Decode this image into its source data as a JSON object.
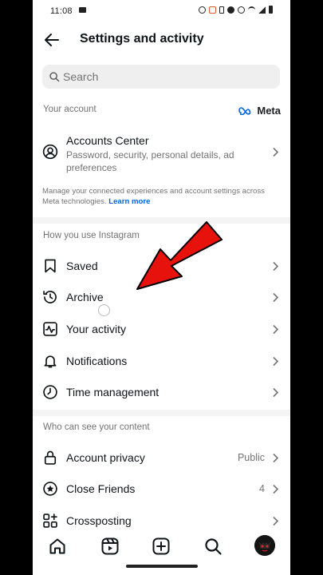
{
  "status_bar": {
    "time": "11:08"
  },
  "header": {
    "title": "Settings and activity"
  },
  "search": {
    "placeholder": "Search"
  },
  "your_account": {
    "label": "Your account",
    "brand": "Meta",
    "accounts_center": {
      "title": "Accounts Center",
      "subtitle": "Password, security, personal details, ad preferences"
    },
    "note": "Manage your connected experiences and account settings across Meta technologies.",
    "learn_more": "Learn more"
  },
  "how_you_use": {
    "label": "How you use Instagram",
    "items": [
      {
        "label": "Saved",
        "icon": "bookmark-icon"
      },
      {
        "label": "Archive",
        "icon": "archive-icon"
      },
      {
        "label": "Your activity",
        "icon": "activity-icon"
      },
      {
        "label": "Notifications",
        "icon": "bell-icon"
      },
      {
        "label": "Time management",
        "icon": "clock-icon"
      }
    ]
  },
  "who_can_see": {
    "label": "Who can see your content",
    "items": [
      {
        "label": "Account privacy",
        "value": "Public",
        "icon": "lock-icon"
      },
      {
        "label": "Close Friends",
        "value": "4",
        "icon": "star-circle-icon"
      },
      {
        "label": "Crossposting",
        "value": "",
        "icon": "grid-plus-icon"
      }
    ]
  },
  "annotation": {
    "arrow_color": "#e8120c"
  },
  "bottom_nav": [
    "home-icon",
    "reels-icon",
    "create-icon",
    "search-icon",
    "profile-avatar"
  ]
}
